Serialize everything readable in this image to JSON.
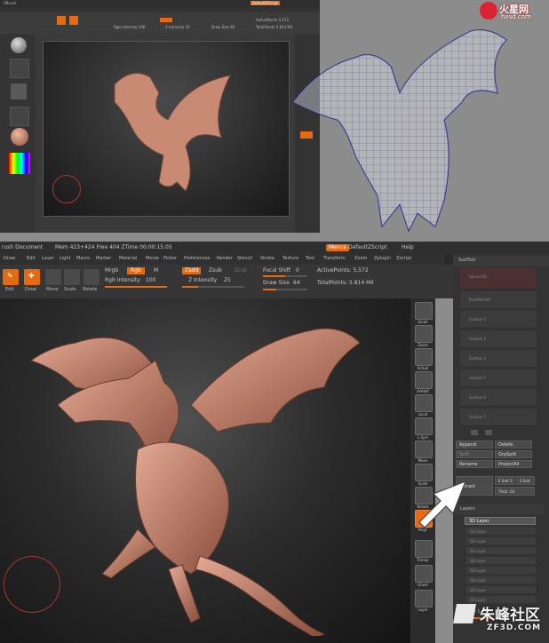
{
  "watermarks": {
    "top_logo": "火星网",
    "top_url": "hxsd.com",
    "bottom_logo": "朱峰社区",
    "bottom_url": "ZF3D.COM"
  },
  "bottom": {
    "title": "rush Document",
    "stats": "Mem 423+424  Free 404  ZTime 00:00:15.05",
    "menus_btn": "Menus",
    "default_script": "DefaultZScript",
    "help": "Help",
    "menu_items": [
      "Draw",
      "Edit",
      "Layer",
      "Light",
      "Macro",
      "Marker",
      "Material",
      "Movie",
      "Picker",
      "Preferences",
      "Render",
      "Stencil",
      "Stroke",
      "Texture",
      "Tool",
      "Transform",
      "Zoom",
      "Zplugin",
      "Zscript"
    ],
    "toolbar": {
      "edit": "Edit",
      "draw": "Draw",
      "move": "Move",
      "scale": "Scale",
      "rotate": "Rotate",
      "mrgb": "Mrgb",
      "rgb": "Rgb",
      "m": "M",
      "rgb_intensity_label": "Rgb Intensity",
      "rgb_intensity_value": "100",
      "rgb_intensity_pct": 100,
      "zadd": "Zadd",
      "zsub": "Zsub",
      "zcut": "Zcut",
      "z_intensity_label": "Z Intensity",
      "z_intensity_value": "25",
      "z_intensity_pct": 25,
      "focal_label": "Focal Shift",
      "focal_value": "0",
      "draw_size_label": "Draw Size",
      "draw_size_value": "64",
      "active_points": "ActivePoints: 5,572",
      "total_points": "TotalPoints: 5.814 Mil"
    },
    "right_shelf": [
      {
        "label": "Scroll"
      },
      {
        "label": "Zoom"
      },
      {
        "label": "Actual"
      },
      {
        "label": "AAHalf"
      },
      {
        "label": "Local"
      },
      {
        "label": "L.Sym"
      },
      {
        "label": "Move"
      },
      {
        "label": "Scale"
      },
      {
        "label": "Rotate"
      },
      {
        "label": "PolyF"
      },
      {
        "label": "Transp"
      },
      {
        "label": "Ghost"
      },
      {
        "label": "Layer"
      }
    ],
    "subtool": {
      "header": "SubTool",
      "items": [
        "Sphere3D",
        "PolyMesh3D",
        "Subtool 2",
        "Subtool 3",
        "Subtool 4",
        "Subtool 5",
        "Subtool 6",
        "Subtool 7"
      ],
      "append": "Append",
      "delete": "Delete",
      "split": "Split",
      "grpsplit": "GrpSplit",
      "rename": "Rename",
      "projectall": "ProjectAll",
      "extract": "Extract",
      "esmt": "E Smt 5",
      "smt": "S Smt",
      "thick": "Thick .03"
    },
    "layers": {
      "header": "Layers",
      "active": "3D Layer",
      "items": [
        "3D Layer",
        "3D Layer",
        "3D Layer",
        "3D Layer",
        "3D Layer",
        "3D Layer",
        "3D Layer",
        "3D Layer",
        "3D Layer",
        "3D Layer"
      ],
      "intensity": "Intensity 1"
    }
  },
  "top": {
    "title": "ZBrush",
    "default_script": "DefaultZScript",
    "rgb_intensity": "Rgb Intensity 100",
    "z_intensity": "Z Intensity 25",
    "draw_size": "Draw Size 64",
    "active_points": "ActivePoints 5,572",
    "total_points": "TotalPoints 5.814 Mil"
  }
}
